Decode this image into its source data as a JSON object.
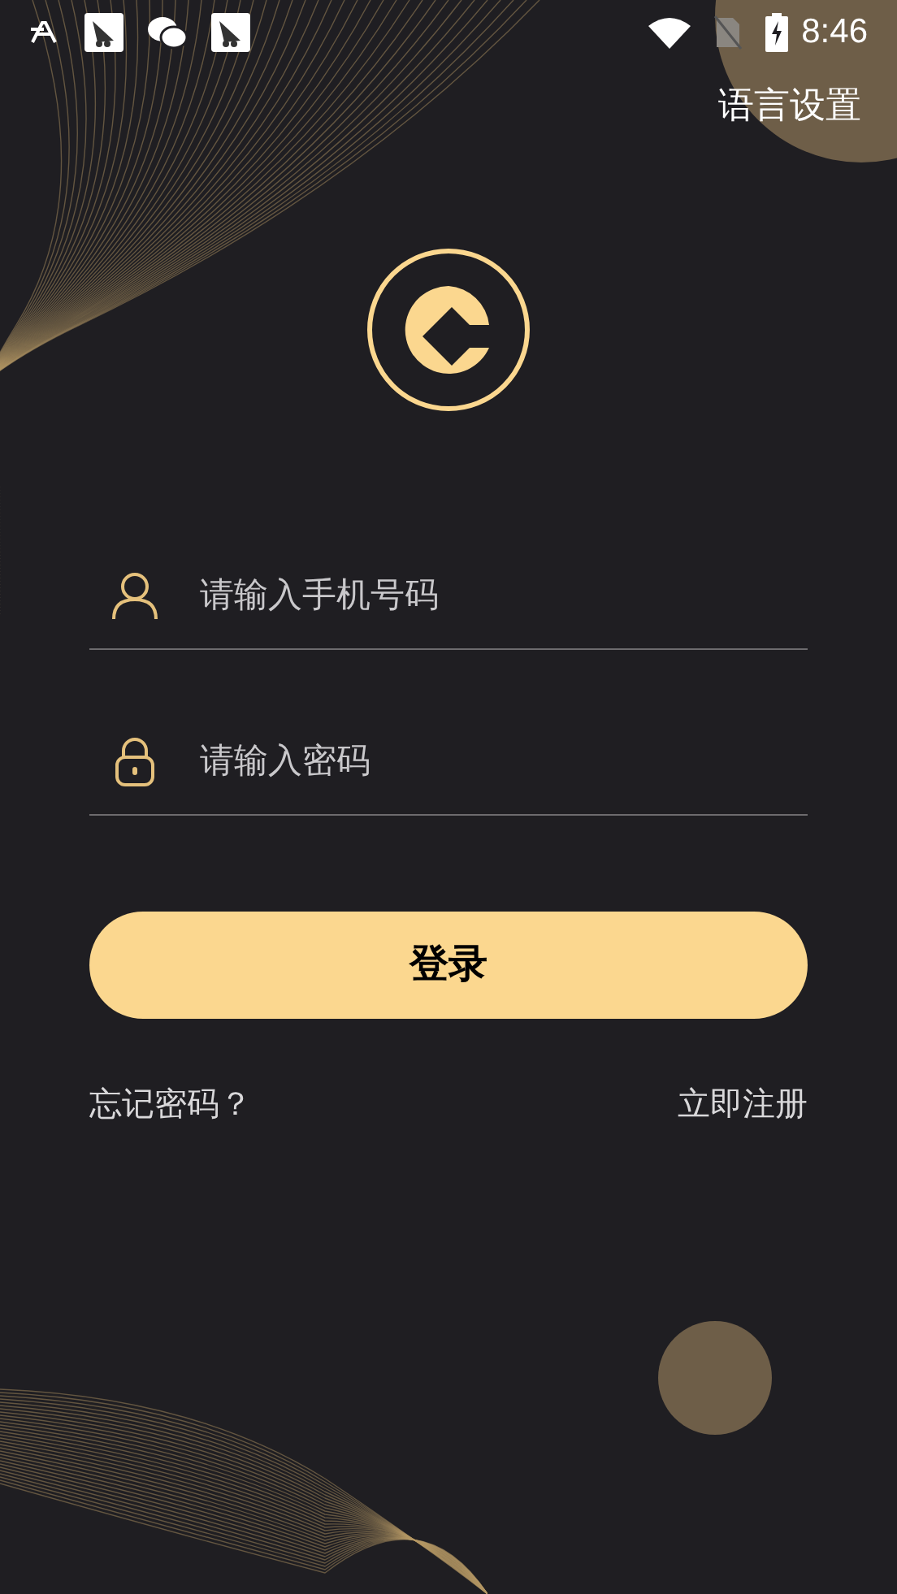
{
  "status_bar": {
    "time": "8:46"
  },
  "header": {
    "language_link": "语言设置"
  },
  "form": {
    "phone": {
      "placeholder": "请输入手机号码"
    },
    "password": {
      "placeholder": "请输入密码"
    },
    "login_button": "登录",
    "forgot_link": "忘记密码？",
    "register_link": "立即注册"
  }
}
